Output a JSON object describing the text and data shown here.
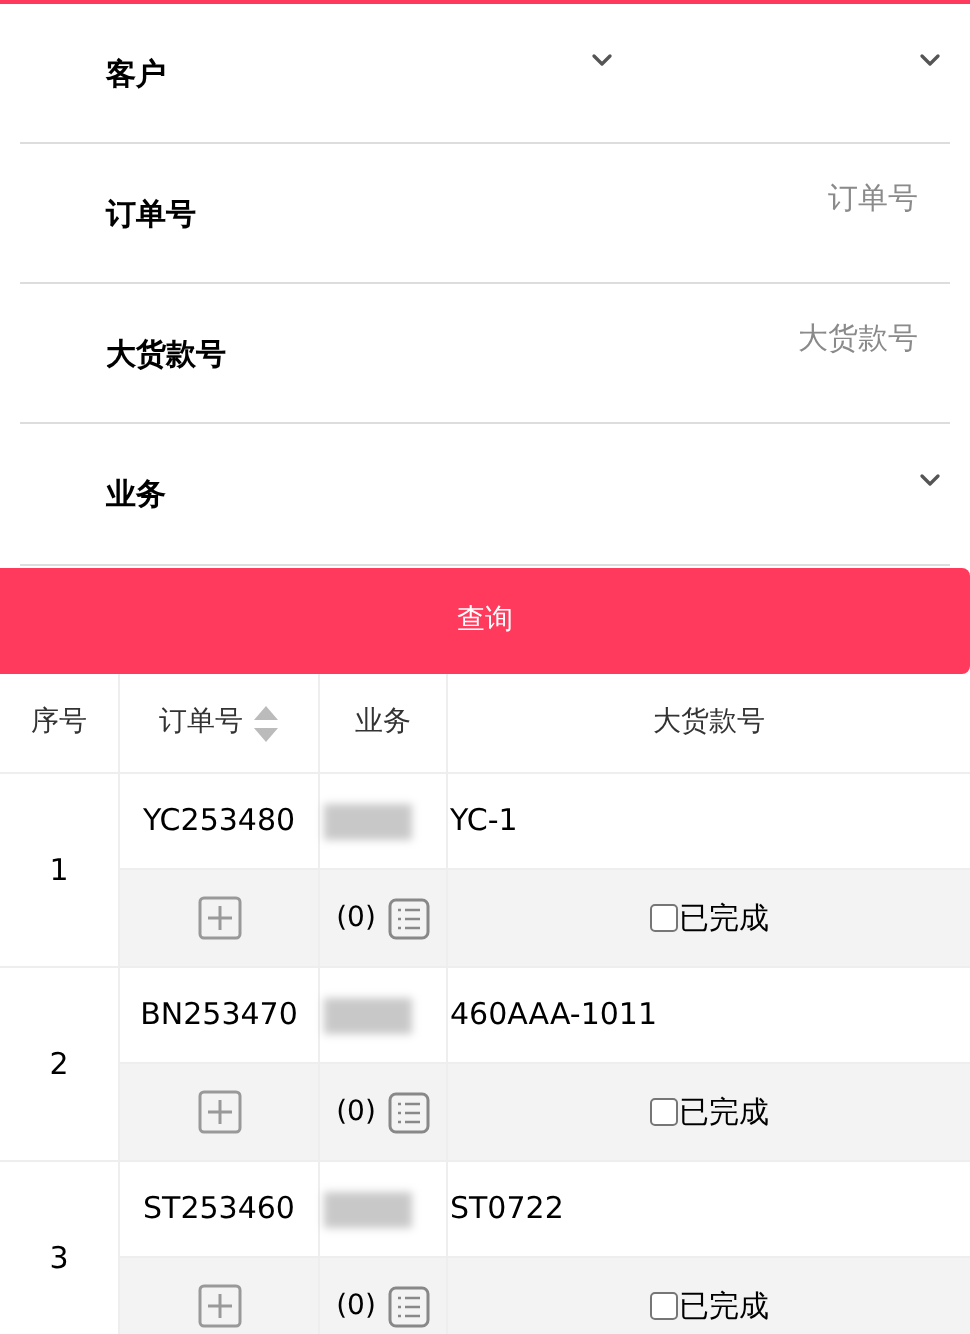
{
  "filters": [
    {
      "kind": "dual_select",
      "label": "客户"
    },
    {
      "kind": "text",
      "label": "订单号",
      "placeholder": "订单号"
    },
    {
      "kind": "text",
      "label": "大货款号",
      "placeholder": "大货款号"
    },
    {
      "kind": "select",
      "label": "业务"
    }
  ],
  "query_button": "查询",
  "table": {
    "columns": [
      {
        "label": "序号",
        "sortable": false
      },
      {
        "label": "订单号",
        "sortable": true
      },
      {
        "label": "业务",
        "sortable": false
      },
      {
        "label": "大货款号",
        "sortable": false
      }
    ],
    "rows": [
      {
        "index": "1",
        "order_no": "YC253480",
        "business_redacted": true,
        "style_no": "YC-1",
        "count": "(0)",
        "done_label": "已完成",
        "checked": false
      },
      {
        "index": "2",
        "order_no": "BN253470",
        "business_redacted": true,
        "style_no": "460AAA-1011",
        "count": "(0)",
        "done_label": "已完成",
        "checked": false
      },
      {
        "index": "3",
        "order_no": "ST253460",
        "business_redacted": true,
        "style_no": "ST0722",
        "count": "(0)",
        "done_label": "已完成",
        "checked": false
      }
    ]
  }
}
